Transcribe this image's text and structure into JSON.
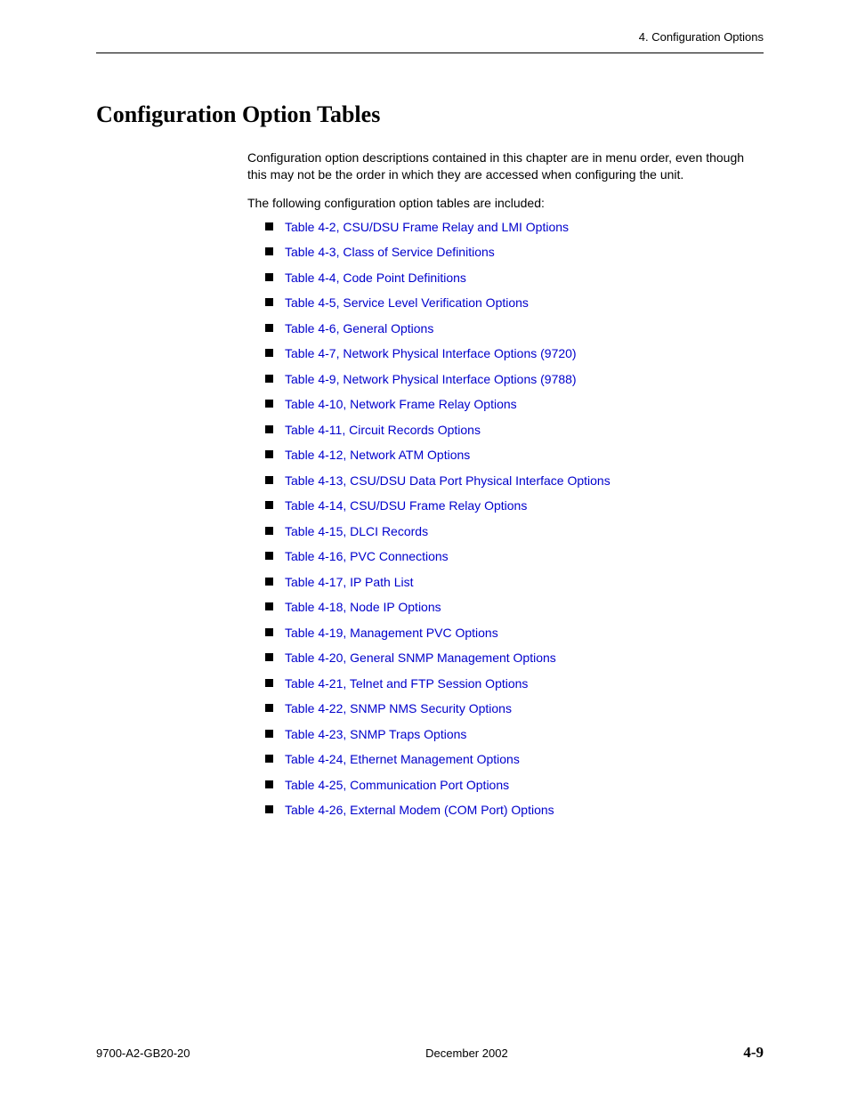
{
  "header": {
    "running_head": "4. Configuration Options"
  },
  "section": {
    "title": "Configuration Option Tables",
    "intro": "Configuration option descriptions contained in this chapter are in menu order, even though this may not be the order in which they are accessed when configuring the unit.",
    "lead": "The following configuration option tables are included:"
  },
  "toc_items": [
    "Table 4-2, CSU/DSU Frame Relay and LMI Options",
    "Table 4-3, Class of Service Definitions",
    "Table 4-4, Code Point Definitions",
    "Table 4-5, Service Level Verification Options",
    "Table 4-6, General Options",
    "Table 4-7, Network Physical Interface Options (9720)",
    "Table 4-9, Network Physical Interface Options (9788)",
    "Table 4-10, Network Frame Relay Options",
    "Table 4-11, Circuit Records Options",
    "Table 4-12, Network ATM Options",
    "Table 4-13, CSU/DSU Data Port Physical Interface Options",
    "Table 4-14, CSU/DSU Frame Relay Options",
    "Table 4-15, DLCI Records",
    "Table 4-16, PVC Connections",
    "Table 4-17, IP Path List",
    "Table 4-18, Node IP Options",
    "Table 4-19, Management PVC Options",
    "Table 4-20, General SNMP Management Options",
    "Table 4-21, Telnet and FTP Session Options",
    "Table 4-22, SNMP NMS Security Options",
    "Table 4-23, SNMP Traps Options",
    "Table 4-24, Ethernet Management Options",
    "Table 4-25, Communication Port Options",
    "Table 4-26, External Modem (COM Port) Options"
  ],
  "footer": {
    "doc_number": "9700-A2-GB20-20",
    "date": "December 2002",
    "page": "4-9"
  }
}
